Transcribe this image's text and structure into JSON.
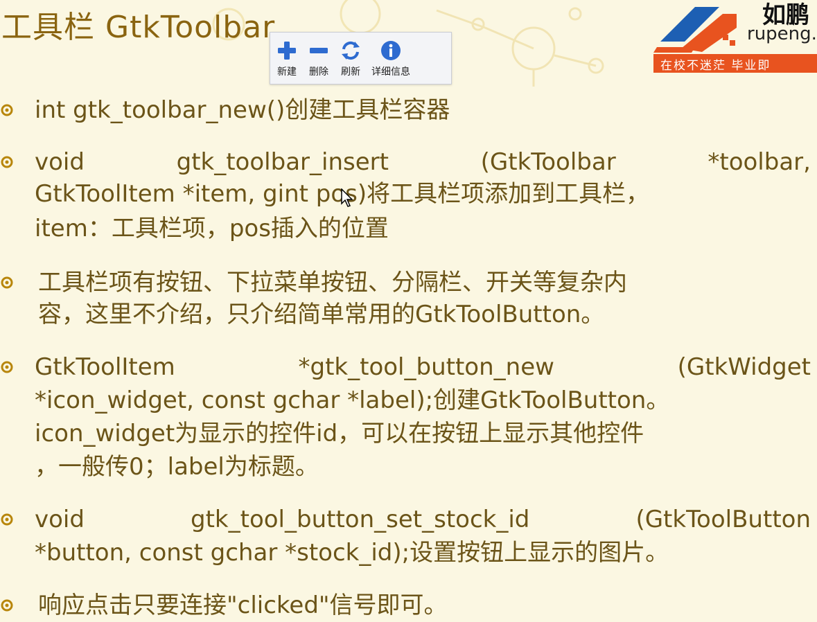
{
  "title": "工具栏 GtkToolbar",
  "toolbar": {
    "buttons": [
      {
        "label": "新建",
        "icon": "plus-icon"
      },
      {
        "label": "删除",
        "icon": "minus-icon"
      },
      {
        "label": "刷新",
        "icon": "refresh-icon"
      },
      {
        "label": "详细信息",
        "icon": "info-icon"
      }
    ]
  },
  "logo": {
    "brand": "如鹏",
    "domain": "rupeng.",
    "slogan": "在校不迷茫  毕业即"
  },
  "bullets": [
    {
      "lines": [
        "int gtk_toolbar_new()创建工具栏容器"
      ]
    },
    {
      "line1_parts": [
        "void",
        "gtk_toolbar_insert",
        "(GtkToolbar",
        "*toolbar,"
      ],
      "line2": "GtkToolItem *item, gint pos)将工具栏项添加到工具栏，",
      "line3": "item：工具栏项，pos插入的位置"
    },
    {
      "line1": "工具栏项有按钮、下拉菜单按钮、分隔栏、开关等复杂内",
      "line2": "容，这里不介绍，只介绍简单常用的GtkToolButton。"
    },
    {
      "line1_parts": [
        "GtkToolItem",
        "*gtk_tool_button_new",
        "(GtkWidget"
      ],
      "line2": "*icon_widget, const gchar *label);创建GtkToolButton。",
      "line3": "icon_widget为显示的控件id，可以在按钮上显示其他控件",
      "line4": "，一般传0；label为标题。"
    },
    {
      "line1_parts": [
        "void",
        "gtk_tool_button_set_stock_id",
        "(GtkToolButton"
      ],
      "line2": "*button, const gchar *stock_id);设置按钮上显示的图片。"
    },
    {
      "lines": [
        "响应点击只要连接\"clicked\"信号即可。"
      ]
    }
  ],
  "colors": {
    "background": "#fbf7e2",
    "text": "#6b5418",
    "title": "#8a6410",
    "bullet": "#b8860b",
    "logo_orange": "#e8531f",
    "logo_blue": "#1d5fb3"
  }
}
